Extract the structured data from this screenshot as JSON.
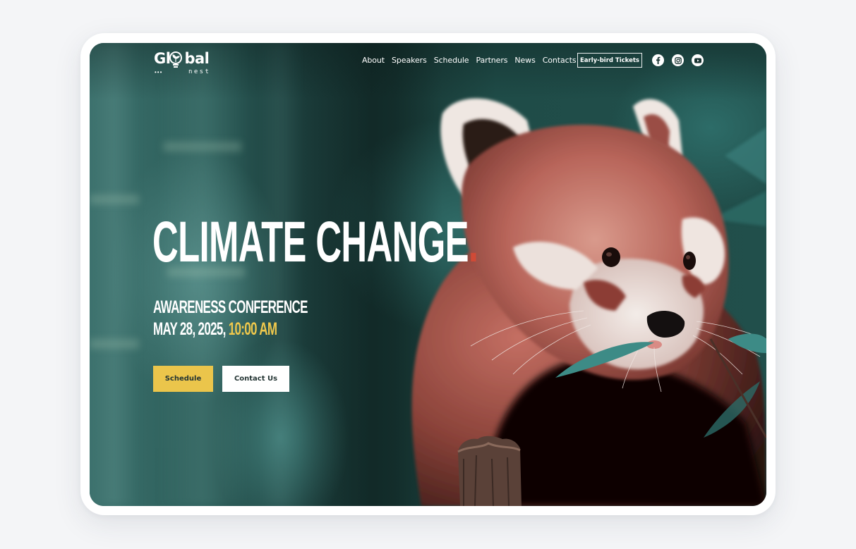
{
  "brand": {
    "name_left": "Gl",
    "name_right": "bal",
    "name_sub": "nest",
    "dots": "•••",
    "logo_icon": "lightbulb-sprout-icon"
  },
  "nav": {
    "items": [
      {
        "label": "About"
      },
      {
        "label": "Speakers"
      },
      {
        "label": "Schedule"
      },
      {
        "label": "Partners"
      },
      {
        "label": "News"
      },
      {
        "label": "Contacts"
      }
    ],
    "cta_label": "Early-bird Tickets",
    "social": [
      {
        "name": "facebook",
        "icon": "facebook-icon"
      },
      {
        "name": "instagram",
        "icon": "instagram-icon"
      },
      {
        "name": "youtube",
        "icon": "youtube-icon"
      }
    ]
  },
  "hero": {
    "title": "CLIMATE CHANGE",
    "title_dot": ".",
    "subtitle": "AWARENESS CONFERENCE",
    "date": "MAY 28, 2025,",
    "time": "10:00 AM",
    "primary_button": "Schedule",
    "secondary_button": "Contact Us",
    "background_image": "red panda eating bamboo leaves against blurred teal bamboo forest"
  },
  "colors": {
    "accent_yellow": "#ebc54b",
    "accent_red": "#d04a36",
    "teal_background": "#1e4a47",
    "text_dark": "#233433"
  }
}
